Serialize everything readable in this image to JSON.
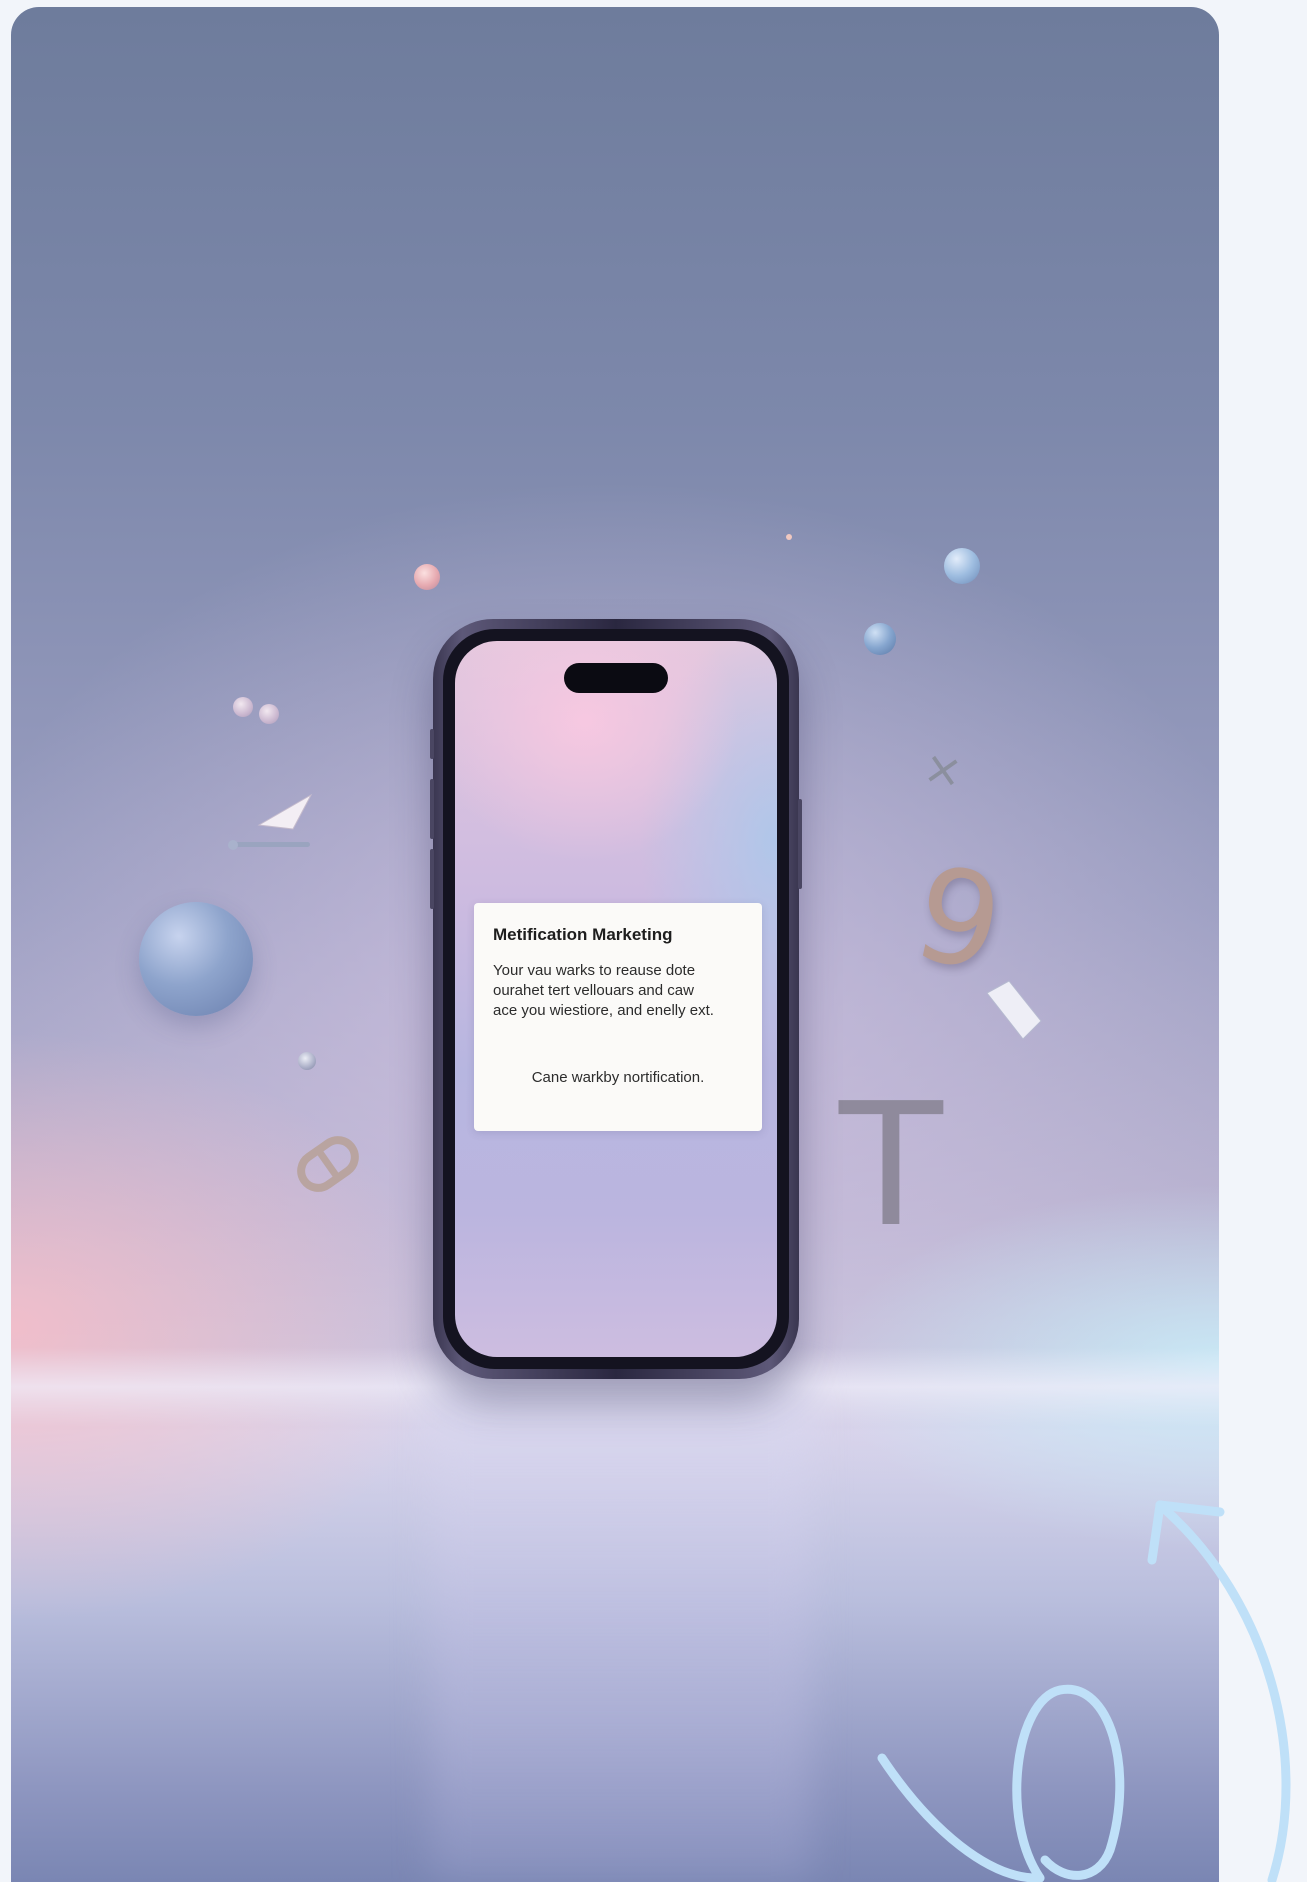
{
  "notification": {
    "title": "Metification Marketing",
    "body_lines": [
      "Your vau warks to reause dote",
      "ourahet tert vellouars and caw",
      "ace you wiestiore, and enelly ext."
    ],
    "footer": "Cane warkby nortification."
  },
  "floating_glyphs": {
    "nine": "9",
    "tee": "T",
    "cross": "×"
  },
  "colors": {
    "page_background": "#f2f5fa",
    "phone_frame": "#2a2740",
    "notification_card": "#fbfaf8",
    "doodle_stroke": "#bfe0f8"
  }
}
